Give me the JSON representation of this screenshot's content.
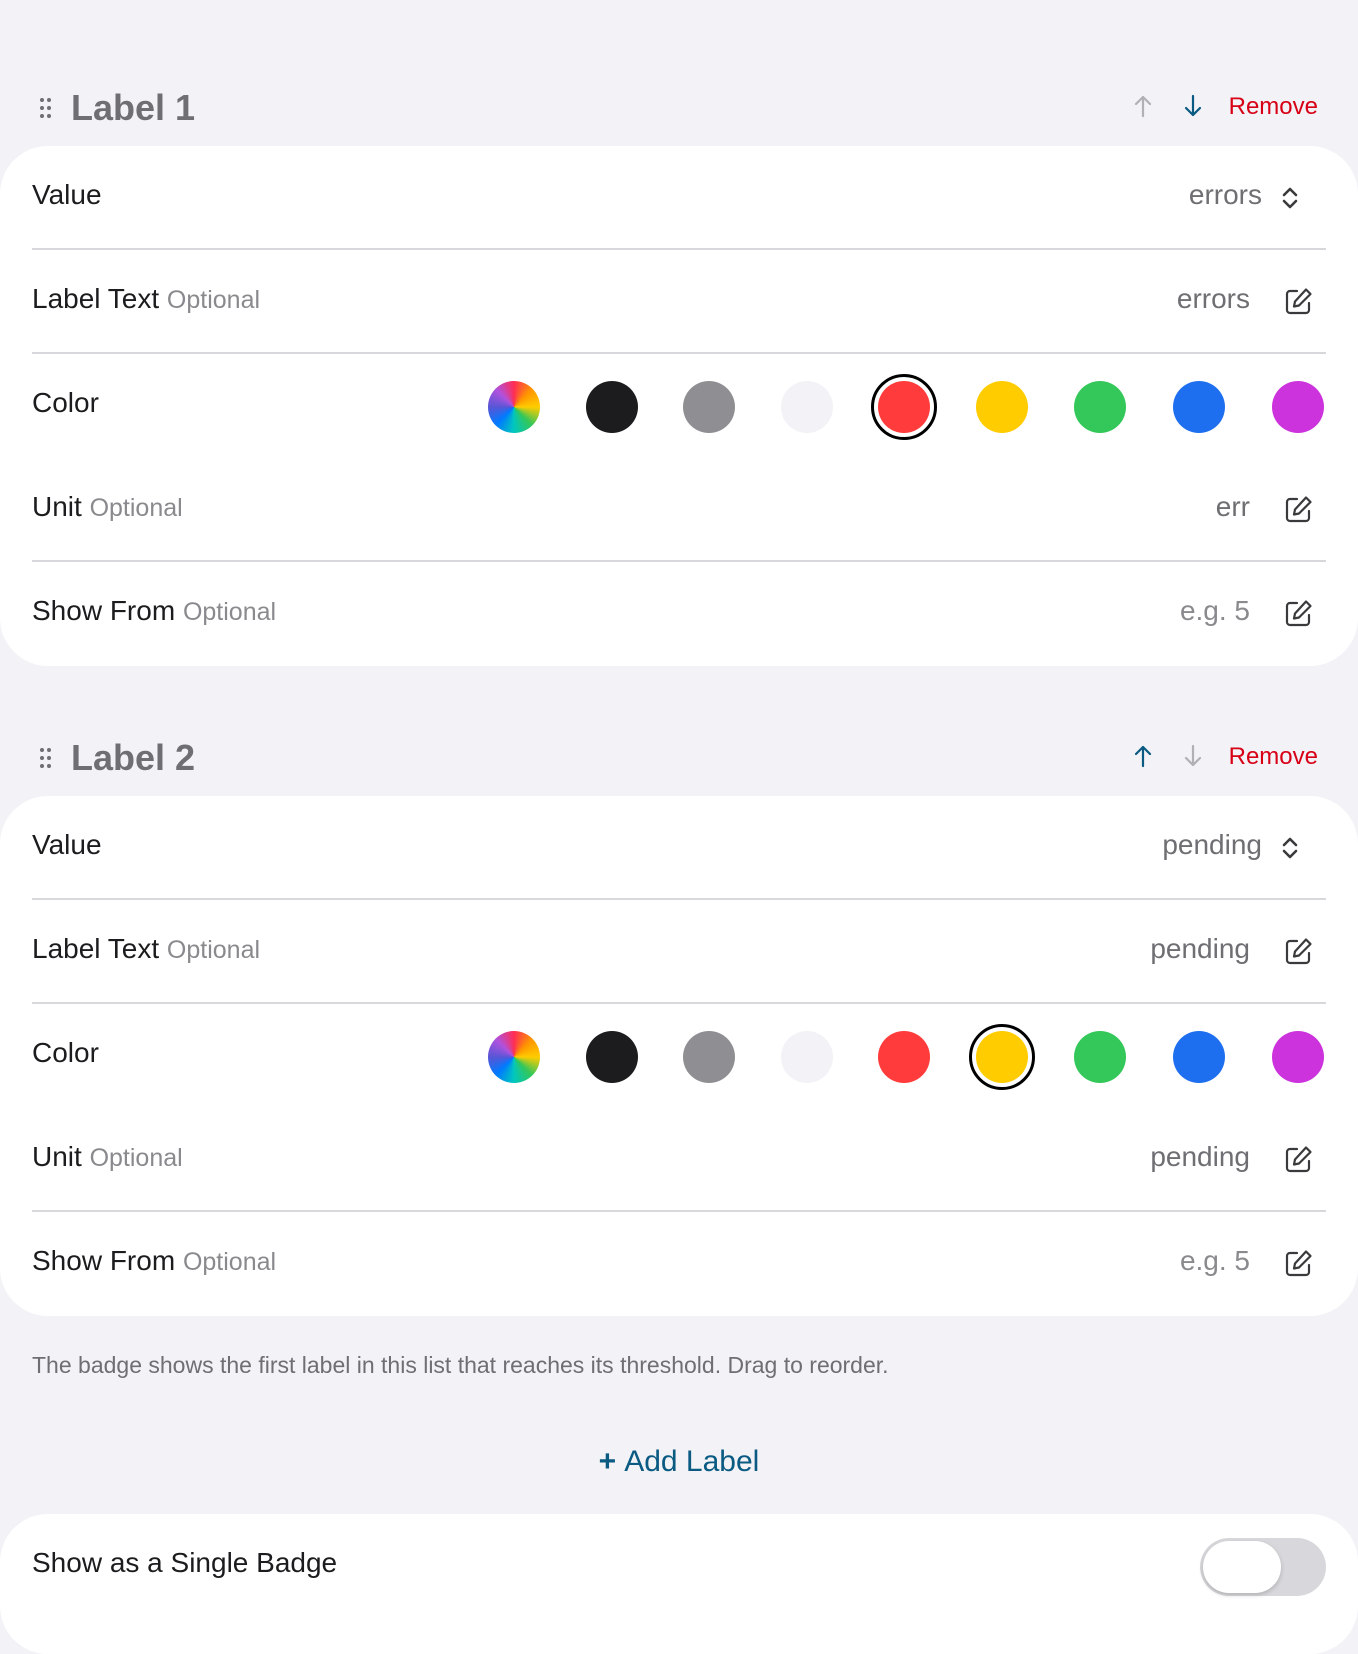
{
  "labels": [
    {
      "title": "Label 1",
      "remove_label": "Remove",
      "up_enabled": false,
      "down_enabled": true,
      "value_label": "Value",
      "value": "errors",
      "label_text_label": "Label Text",
      "label_text_optional": "Optional",
      "label_text_value": "errors",
      "color_label": "Color",
      "selected_color": "red",
      "unit_label": "Unit",
      "unit_optional": "Optional",
      "unit_value": "err",
      "show_from_label": "Show From",
      "show_from_optional": "Optional",
      "show_from_placeholder": "e.g. 5"
    },
    {
      "title": "Label 2",
      "remove_label": "Remove",
      "up_enabled": true,
      "down_enabled": false,
      "value_label": "Value",
      "value": "pending",
      "label_text_label": "Label Text",
      "label_text_optional": "Optional",
      "label_text_value": "pending",
      "color_label": "Color",
      "selected_color": "yellow",
      "unit_label": "Unit",
      "unit_optional": "Optional",
      "unit_value": "pending",
      "show_from_label": "Show From",
      "show_from_optional": "Optional",
      "show_from_placeholder": "e.g. 5"
    }
  ],
  "color_options": [
    {
      "name": "multicolor",
      "hex": "rainbow"
    },
    {
      "name": "black",
      "hex": "#1c1c1e"
    },
    {
      "name": "gray",
      "hex": "#8e8e93"
    },
    {
      "name": "white",
      "hex": "#f2f2f7"
    },
    {
      "name": "red",
      "hex": "#ff3b3b"
    },
    {
      "name": "yellow",
      "hex": "#ffcc00"
    },
    {
      "name": "green",
      "hex": "#34c759"
    },
    {
      "name": "blue",
      "hex": "#1e6ff0"
    },
    {
      "name": "purple",
      "hex": "#cc33dd"
    }
  ],
  "footnote": "The badge shows the first label in this list that reaches its threshold. Drag to reorder.",
  "add_label": {
    "plus": "+",
    "text": "Add Label"
  },
  "single_badge": {
    "label": "Show as a Single Badge",
    "enabled": false
  },
  "accent_colors": {
    "remove": "#d70015",
    "arrow_active": "#0a5a82",
    "arrow_disabled": "#b0b0b5",
    "link": "#0a5a82"
  }
}
